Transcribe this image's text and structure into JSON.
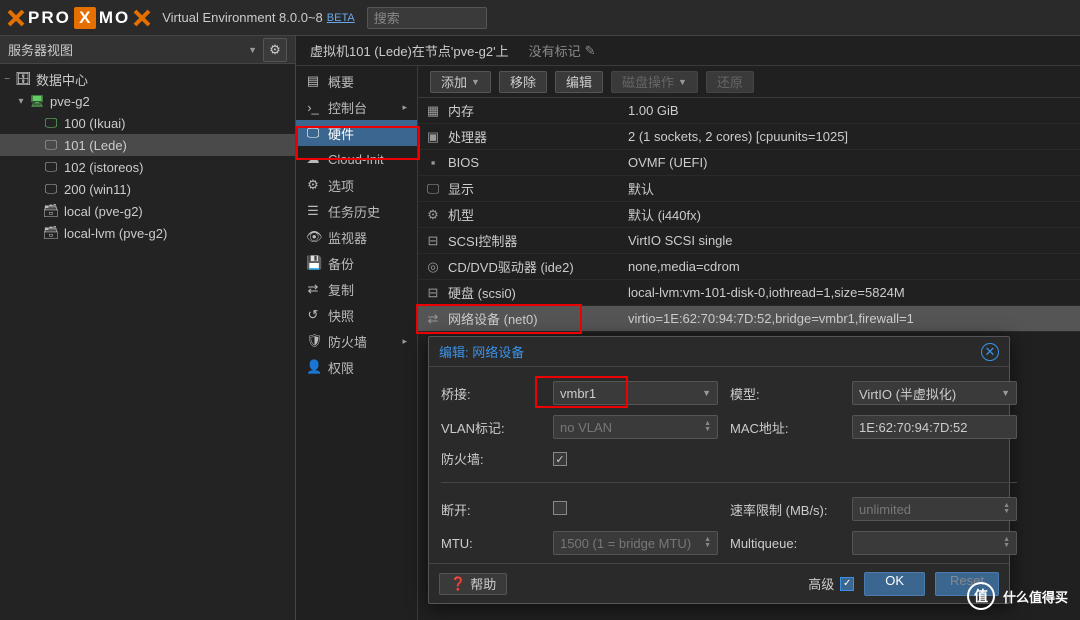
{
  "header": {
    "logo_pre": "PRO",
    "logo_x": "X",
    "logo_post": "MO",
    "product": "Virtual Environment 8.0.0~8",
    "beta": "BETA",
    "search_placeholder": "搜索"
  },
  "left": {
    "view_label": "服务器视图",
    "tree": {
      "dc": "数据中心",
      "node": "pve-g2",
      "vms": [
        {
          "id": "100",
          "name": "Ikuai",
          "label": "100 (Ikuai)"
        },
        {
          "id": "101",
          "name": "Lede",
          "label": "101 (Lede)"
        },
        {
          "id": "102",
          "name": "istoreos",
          "label": "102 (istoreos)"
        },
        {
          "id": "200",
          "name": "win11",
          "label": "200 (win11)"
        }
      ],
      "storage": [
        {
          "label": "local (pve-g2)"
        },
        {
          "label": "local-lvm (pve-g2)"
        }
      ]
    }
  },
  "crumb": {
    "title": "虚拟机101 (Lede)在节点'pve-g2'上",
    "notags": "没有标记"
  },
  "submenu": [
    {
      "icon": "note",
      "label": "概要"
    },
    {
      "icon": "console",
      "label": "控制台",
      "expand": true
    },
    {
      "icon": "hw",
      "label": "硬件",
      "selected": true
    },
    {
      "icon": "cloud",
      "label": "Cloud-Init"
    },
    {
      "icon": "gear",
      "label": "选项"
    },
    {
      "icon": "list",
      "label": "任务历史"
    },
    {
      "icon": "eye",
      "label": "监视器"
    },
    {
      "icon": "save",
      "label": "备份"
    },
    {
      "icon": "retweet",
      "label": "复制"
    },
    {
      "icon": "angle",
      "label": "快照"
    },
    {
      "icon": "shield",
      "label": "防火墙",
      "expand": true
    },
    {
      "icon": "user",
      "label": "权限"
    }
  ],
  "toolbar": {
    "add": "添加",
    "remove": "移除",
    "edit": "编辑",
    "disk": "磁盘操作",
    "revert": "还原"
  },
  "hw": [
    {
      "icon": "mem",
      "label": "内存",
      "value": "1.00 GiB"
    },
    {
      "icon": "cpu",
      "label": "处理器",
      "value": "2 (1 sockets, 2 cores) [cpuunits=1025]"
    },
    {
      "icon": "bios",
      "label": "BIOS",
      "value": "OVMF (UEFI)"
    },
    {
      "icon": "display",
      "label": "显示",
      "value": "默认"
    },
    {
      "icon": "machine",
      "label": "机型",
      "value": "默认 (i440fx)"
    },
    {
      "icon": "scsi",
      "label": "SCSI控制器",
      "value": "VirtIO SCSI single"
    },
    {
      "icon": "cd",
      "label": "CD/DVD驱动器 (ide2)",
      "value": "none,media=cdrom"
    },
    {
      "icon": "hdd",
      "label": "硬盘 (scsi0)",
      "value": "local-lvm:vm-101-disk-0,iothread=1,size=5824M"
    },
    {
      "icon": "net",
      "label": "网络设备 (net0)",
      "value": "virtio=1E:62:70:94:7D:52,bridge=vmbr1,firewall=1",
      "selected": true
    }
  ],
  "dialog": {
    "title": "编辑: 网络设备",
    "fields": {
      "bridge_label": "桥接:",
      "bridge_value": "vmbr1",
      "model_label": "模型:",
      "model_value": "VirtIO (半虚拟化)",
      "vlan_label": "VLAN标记:",
      "vlan_placeholder": "no VLAN",
      "mac_label": "MAC地址:",
      "mac_value": "1E:62:70:94:7D:52",
      "firewall_label": "防火墙:",
      "firewall_checked": true,
      "disconnect_label": "断开:",
      "disconnect_checked": false,
      "rate_label": "速率限制 (MB/s):",
      "rate_placeholder": "unlimited",
      "mtu_label": "MTU:",
      "mtu_placeholder": "1500 (1 = bridge MTU)",
      "multiqueue_label": "Multiqueue:"
    },
    "help": "帮助",
    "advanced": "高级",
    "ok": "OK",
    "reset": "Reset"
  },
  "watermark": "什么值得买"
}
